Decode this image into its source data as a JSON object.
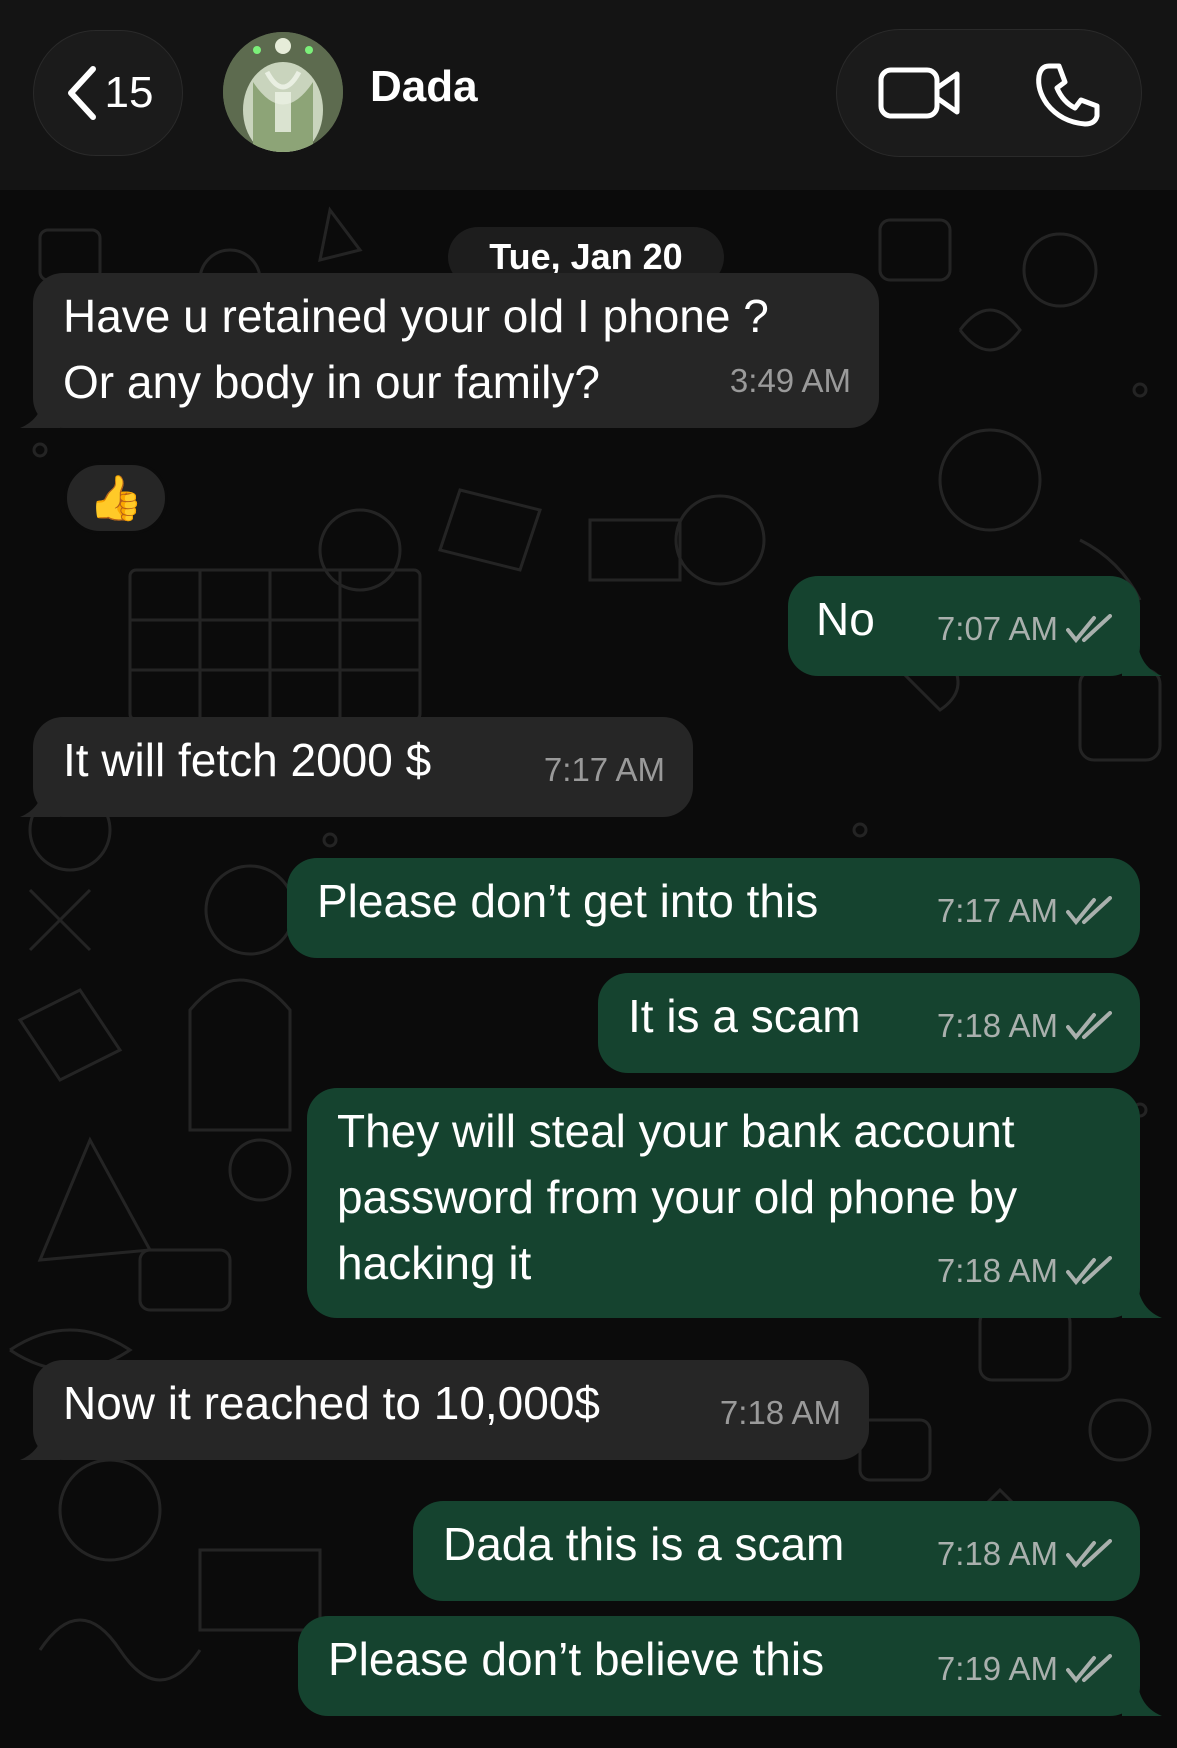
{
  "header": {
    "back_count": "15",
    "contact_name": "Dada"
  },
  "chat": {
    "date": "Tue, Jan 20",
    "reaction": "👍",
    "messages": [
      {
        "dir": "in",
        "lines": [
          "Have u retained your old I phone ?",
          "Or any body in our family?"
        ],
        "time": "3:49 AM"
      },
      {
        "dir": "out",
        "lines": [
          "No"
        ],
        "time": "7:07 AM"
      },
      {
        "dir": "in",
        "lines": [
          "It will fetch 2000 $"
        ],
        "time": "7:17 AM"
      },
      {
        "dir": "out",
        "lines": [
          "Please don’t get into this"
        ],
        "time": "7:17 AM"
      },
      {
        "dir": "out",
        "lines": [
          "It is a scam"
        ],
        "time": "7:18 AM"
      },
      {
        "dir": "out",
        "lines": [
          "They will steal your bank account",
          "password from your old phone by",
          "hacking it"
        ],
        "time": "7:18 AM"
      },
      {
        "dir": "in",
        "lines": [
          "Now it reached to 10,000$"
        ],
        "time": "7:18 AM"
      },
      {
        "dir": "out",
        "lines": [
          "Dada this is a scam"
        ],
        "time": "7:18 AM"
      },
      {
        "dir": "out",
        "lines": [
          "Please don’t believe this"
        ],
        "time": "7:19 AM"
      }
    ]
  },
  "colors": {
    "incoming_bubble": "#262626",
    "outgoing_bubble": "#15432f",
    "read_ticks": "#a9b0ad"
  },
  "icons": [
    "chevron-left-icon",
    "video-call-icon",
    "phone-call-icon",
    "double-check-icon"
  ]
}
